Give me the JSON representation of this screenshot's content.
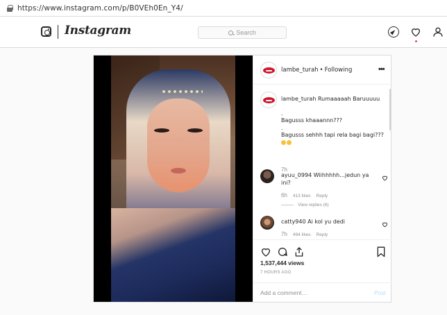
{
  "browser": {
    "url": "https://www.instagram.com/p/B0VEh0En_Y4/"
  },
  "header": {
    "logo_text": "Instagram",
    "search_placeholder": "Search",
    "icons": [
      "instagram-camera-icon",
      "compass-icon",
      "heart-icon",
      "user-icon"
    ]
  },
  "post": {
    "username": "lambe_turah",
    "follow_status": "Following",
    "separator": "•",
    "more": "•••",
    "caption": {
      "username": "lambe_turah",
      "lines": [
        "Rumaaaaah Baruuuuu",
        ".",
        "Bagusss khaaannn???",
        ".",
        "Bagusss sehhh tapi rela bagi bagi???"
      ],
      "emoji_count": 2,
      "time": "7h"
    },
    "comments": [
      {
        "username": "ayuu_0994",
        "text": "Wiihhhhh...jedun ya ini?",
        "time": "6h",
        "likes": "413 likes",
        "reply": "Reply",
        "view_replies": "View replies (6)"
      },
      {
        "username": "catty940",
        "text": "Ai kol yu dedi",
        "time": "7h",
        "likes": "494 likes",
        "reply": "Reply"
      }
    ],
    "views": "1,537,444 views",
    "posted_ago": "7 HOURS AGO",
    "add_comment_placeholder": "Add a comment…",
    "post_button": "Post"
  },
  "colors": {
    "accent_red": "#ed4956",
    "post_button_disabled": "#b2dffc",
    "brand_lips": "#d0162a"
  }
}
